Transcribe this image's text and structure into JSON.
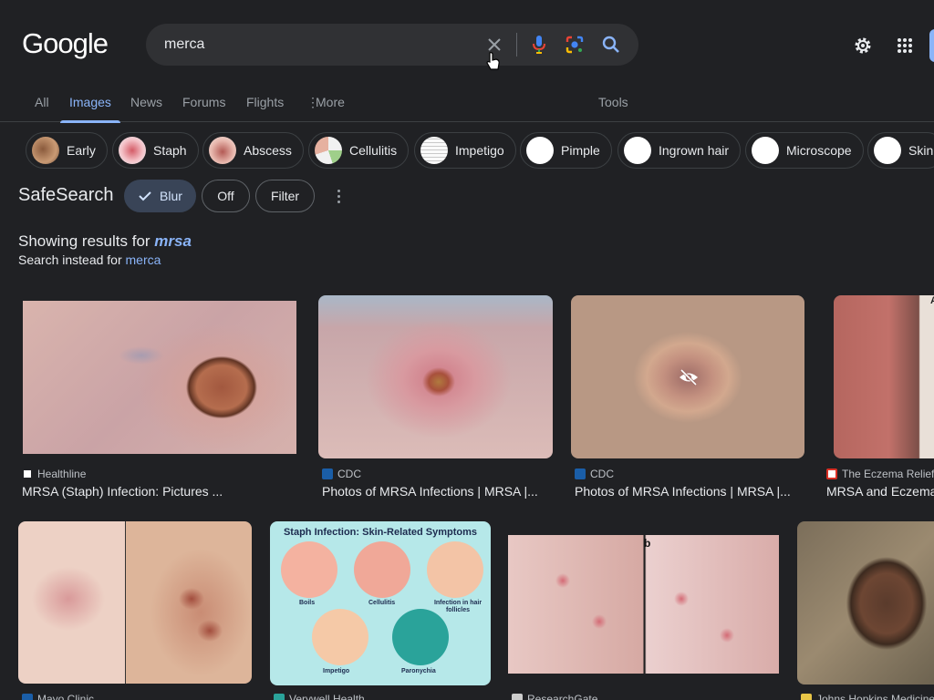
{
  "logo": "Google",
  "search": {
    "value": "merca"
  },
  "tabs": [
    "All",
    "Images",
    "News",
    "Forums",
    "Flights",
    "More",
    "Tools"
  ],
  "chips": [
    "Early",
    "Staph",
    "Abscess",
    "Cellulitis",
    "Impetigo",
    "Pimple",
    "Ingrown hair",
    "Microscope",
    "Skin"
  ],
  "safesearch": {
    "label": "SafeSearch",
    "blur": "Blur",
    "off": "Off",
    "filter": "Filter"
  },
  "showing": {
    "prefix": "Showing results for ",
    "query": "mrsa",
    "instead_prefix": "Search instead for ",
    "instead_query": "merca"
  },
  "results": [
    {
      "source": "Healthline",
      "title": "MRSA (Staph) Infection: Pictures ..."
    },
    {
      "source": "CDC",
      "title": "Photos of MRSA Infections | MRSA |..."
    },
    {
      "source": "CDC",
      "title": "Photos of MRSA Infections | MRSA |..."
    },
    {
      "source": "The Eczema Relief",
      "title": "MRSA and Eczema"
    },
    {
      "source": "Mayo Clinic",
      "title": ""
    },
    {
      "source": "Verywell Health",
      "title": ""
    },
    {
      "source": "ResearchGate",
      "title": ""
    },
    {
      "source": "Johns Hopkins Medicine",
      "title": ""
    }
  ],
  "infographic": {
    "title": "Staph Infection: Skin-Related Symptoms",
    "labels": [
      "Boils",
      "Cellulitis",
      "Infection in hair follicles",
      "Impetigo",
      "Paronychia"
    ]
  },
  "image_text": {
    "panel_b": "b",
    "partial_after": "Af"
  },
  "colors": {
    "accent": "#8ab4f8",
    "background": "#202124",
    "searchbox": "#303134"
  }
}
